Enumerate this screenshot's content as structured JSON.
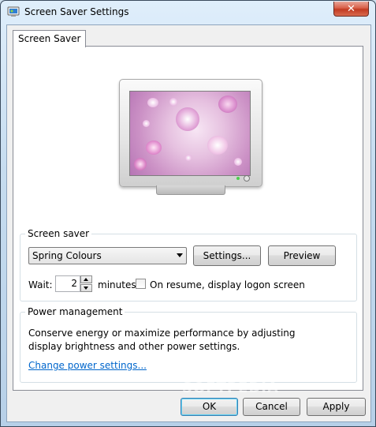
{
  "window": {
    "title": "Screen Saver Settings",
    "close_label": "✕"
  },
  "tabs": [
    {
      "label": "Screen Saver",
      "active": true
    }
  ],
  "preview": {
    "theme_colors": [
      "#f7e6f4",
      "#e6c1e0",
      "#cc92c6",
      "#b574b4"
    ]
  },
  "screen_saver": {
    "group_label": "Screen saver",
    "selected": "Spring Colours",
    "settings_label": "Settings...",
    "preview_label": "Preview",
    "wait_label": "Wait:",
    "wait_value": "2",
    "minutes_label": "minutes",
    "resume_label": "On resume, display logon screen",
    "resume_checked": false
  },
  "power": {
    "group_label": "Power management",
    "description": "Conserve energy or maximize performance by adjusting display brightness and other power settings.",
    "link_label": "Change power settings..."
  },
  "footer": {
    "ok_label": "OK",
    "cancel_label": "Cancel",
    "apply_label": "Apply"
  },
  "watermark": "SOFTPEDIA"
}
